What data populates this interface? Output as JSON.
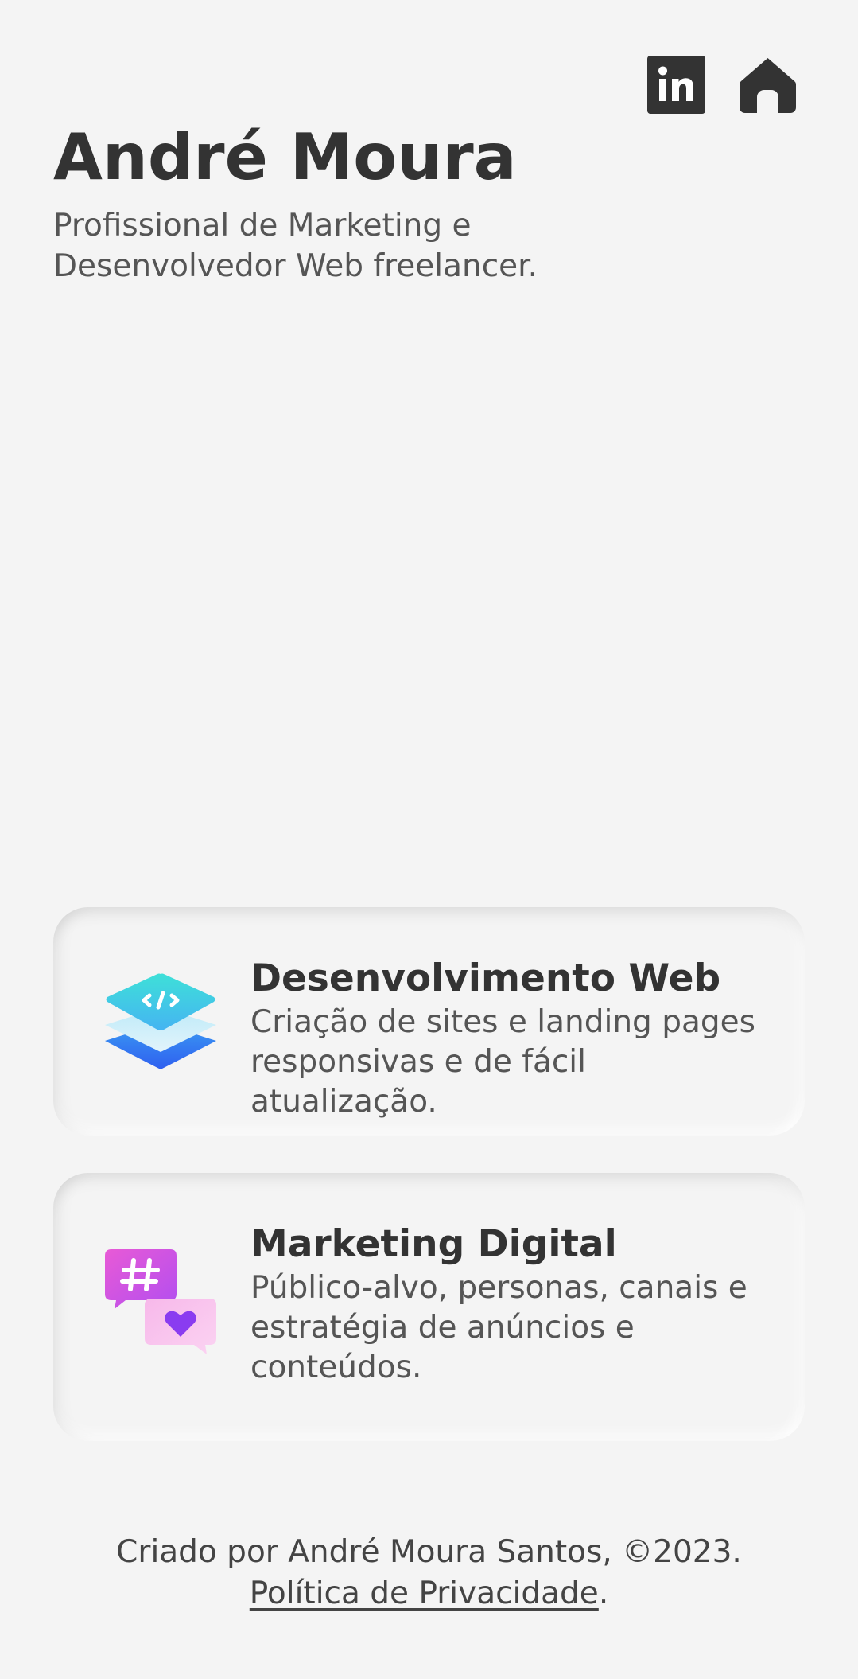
{
  "header": {
    "name": "André Moura",
    "tagline": "Profissional de Marketing e Desenvolvedor Web freelancer."
  },
  "nav": {
    "linkedin_icon": "linkedin-icon",
    "home_icon": "home-icon"
  },
  "services": [
    {
      "icon": "web-layers-code-icon",
      "title": "Desenvolvimento Web",
      "description": "Criação de sites e landing pages responsivas e de fácil atualização."
    },
    {
      "icon": "hashtag-heart-chat-icon",
      "title": "Marketing Digital",
      "description": "Público-alvo, personas, canais e estratégia de anúncios e conteúdos."
    }
  ],
  "footer": {
    "credit": "Criado por André Moura Santos, ©2023.",
    "privacy_link": "Política de Privacidade",
    "trailing": "."
  },
  "colors": {
    "background": "#f4f4f4",
    "text_dark": "#333333",
    "text_muted": "#555555",
    "web_icon_top": "#3ee0d8",
    "web_icon_bottom": "#2f6ff0",
    "mkt_icon_primary": "#d656e8",
    "mkt_icon_secondary": "#f6a6e4"
  }
}
